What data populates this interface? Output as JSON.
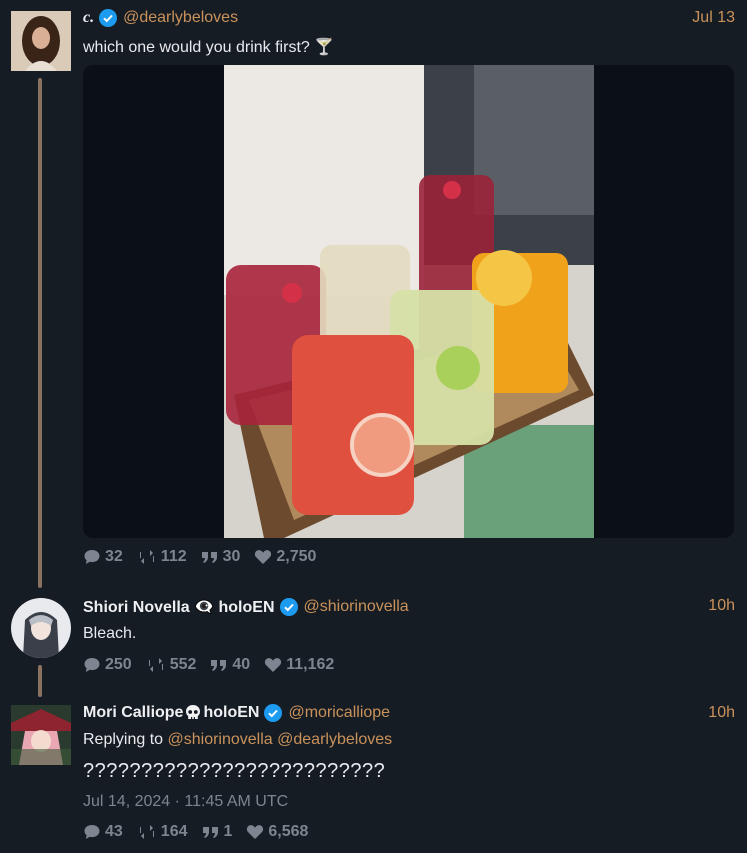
{
  "tweet1": {
    "display_name": "c.",
    "handle": "@dearlybeloves",
    "time": "Jul 13",
    "text": "which one would you drink first? 🍸",
    "stats": {
      "replies": "32",
      "retweets": "112",
      "quotes": "30",
      "likes": "2,750"
    }
  },
  "tweet2": {
    "display_name": "Shiori Novella 👁‍🗨 holoEN",
    "handle": "@shiorinovella",
    "time": "10h",
    "text": "Bleach.",
    "stats": {
      "replies": "250",
      "retweets": "552",
      "quotes": "40",
      "likes": "11,162"
    }
  },
  "tweet3": {
    "display_name": "Mori Calliope",
    "name_suffix": "holoEN",
    "handle": "@moricalliope",
    "time": "10h",
    "reply_prefix": "Replying to",
    "reply_to_1": "@shiorinovella",
    "reply_to_2": "@dearlybeloves",
    "text": "??????????????????????????",
    "date": "Jul 14, 2024 · 11:45 AM UTC",
    "stats": {
      "replies": "43",
      "retweets": "164",
      "quotes": "1",
      "likes": "6,568"
    }
  },
  "colors": {
    "background": "#161c24",
    "accent": "#c9925a",
    "muted": "#7c8590",
    "verified": "#1d9bf0",
    "thread_line": "#8a7160"
  },
  "icons": [
    "reply-icon",
    "retweet-icon",
    "quote-icon",
    "heart-icon",
    "verified-badge-icon",
    "skull-icon"
  ]
}
